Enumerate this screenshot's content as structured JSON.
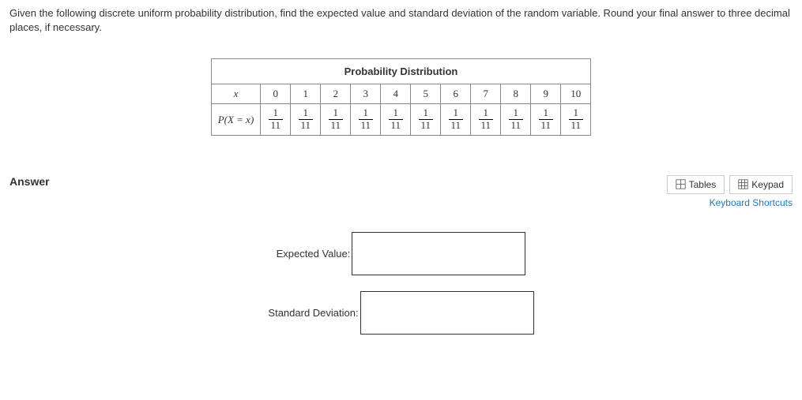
{
  "question": "Given the following discrete uniform probability distribution, find the expected value and standard deviation of the random variable. Round your final answer to three decimal places, if necessary.",
  "table": {
    "title": "Probability Distribution",
    "row_label_x": "x",
    "row_label_px": "P(X = x)",
    "x_values": [
      "0",
      "1",
      "2",
      "3",
      "4",
      "5",
      "6",
      "7",
      "8",
      "9",
      "10"
    ],
    "fractions": [
      {
        "num": "1",
        "den": "11"
      },
      {
        "num": "1",
        "den": "11"
      },
      {
        "num": "1",
        "den": "11"
      },
      {
        "num": "1",
        "den": "11"
      },
      {
        "num": "1",
        "den": "11"
      },
      {
        "num": "1",
        "den": "11"
      },
      {
        "num": "1",
        "den": "11"
      },
      {
        "num": "1",
        "den": "11"
      },
      {
        "num": "1",
        "den": "11"
      },
      {
        "num": "1",
        "den": "11"
      },
      {
        "num": "1",
        "den": "11"
      }
    ]
  },
  "answer_section": {
    "heading": "Answer",
    "tables_btn": "Tables",
    "keypad_btn": "Keypad",
    "shortcuts": "Keyboard Shortcuts",
    "ev_label": "Expected Value:",
    "sd_label": "Standard Deviation:",
    "ev_value": "",
    "sd_value": ""
  }
}
